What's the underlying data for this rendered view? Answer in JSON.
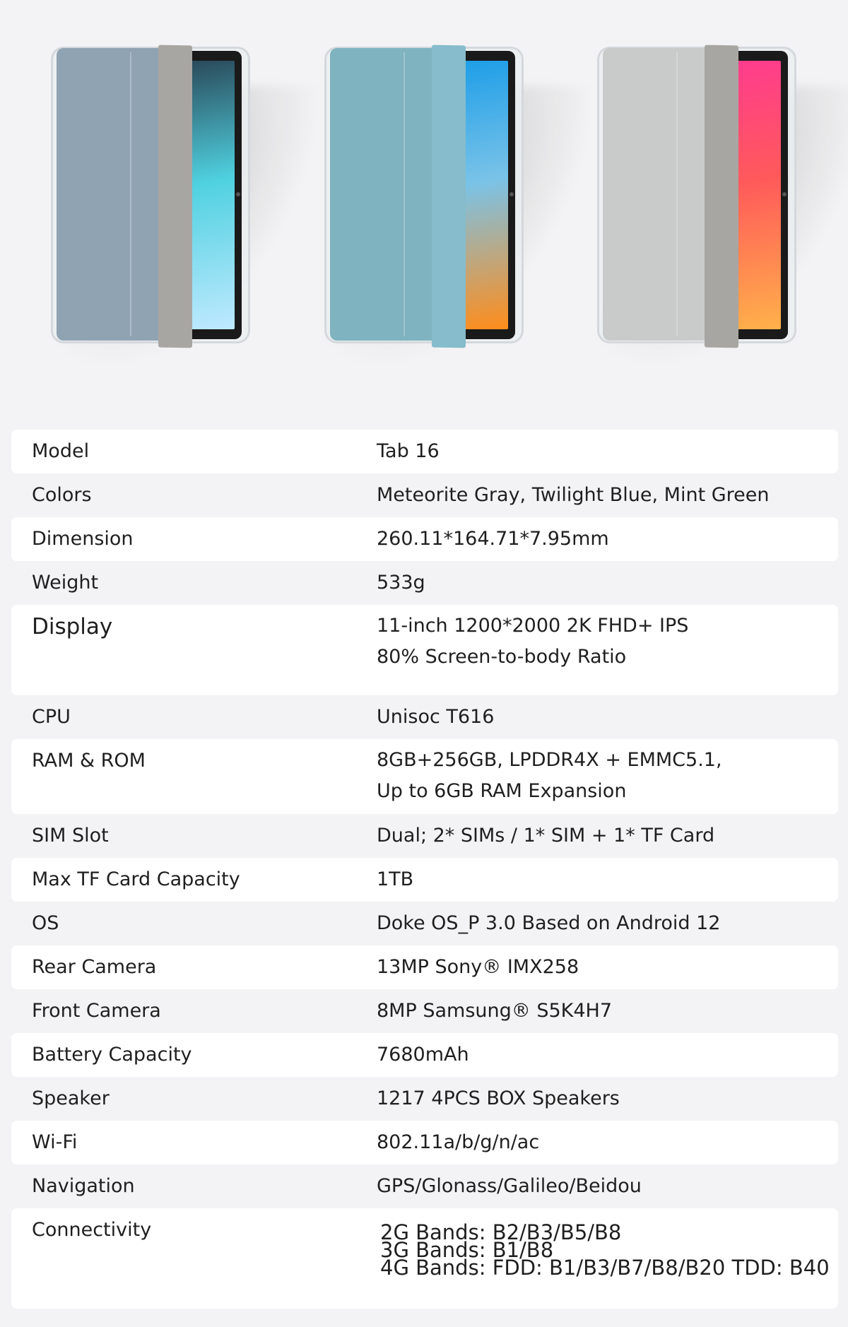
{
  "products": [
    {
      "name": "Meteorite Gray",
      "cover_color": "#8fa3b3",
      "flap_color": "#a8a6a2",
      "screen_colors": [
        "#2a4a5a",
        "#4fd1e0",
        "#bfe9ff"
      ]
    },
    {
      "name": "Twilight Blue",
      "cover_color": "#7fb3bf",
      "flap_color": "#86bccb",
      "screen_colors": [
        "#1e9ee8",
        "#7ac3e8",
        "#ff8c1a"
      ]
    },
    {
      "name": "Mint Green",
      "cover_color": "#c9cbcb",
      "flap_color": "#a8a6a2",
      "screen_colors": [
        "#ff3c8e",
        "#ff5a5a",
        "#ffb14a"
      ]
    }
  ],
  "specs": [
    {
      "label": "Model",
      "value": [
        "Tab 16"
      ]
    },
    {
      "label": "Colors",
      "value": [
        "Meteorite Gray, Twilight Blue, Mint Green"
      ]
    },
    {
      "label": "Dimension",
      "value": [
        "260.11*164.71*7.95mm"
      ]
    },
    {
      "label": "Weight",
      "value": [
        "533g"
      ]
    },
    {
      "label": "Display",
      "value": [
        "11-inch 1200*2000 2K FHD+ IPS",
        "80% Screen-to-body Ratio"
      ]
    },
    {
      "label": "CPU",
      "value": [
        "Unisoc T616"
      ]
    },
    {
      "label": "RAM & ROM",
      "value": [
        "8GB+256GB, LPDDR4X + EMMC5.1,",
        "Up to 6GB RAM Expansion"
      ]
    },
    {
      "label": "SIM Slot",
      "value": [
        "Dual; 2* SIMs / 1* SIM + 1* TF Card"
      ]
    },
    {
      "label": "Max TF Card Capacity",
      "value": [
        "1TB"
      ]
    },
    {
      "label": "OS",
      "value": [
        "Doke OS_P 3.0 Based on Android 12"
      ]
    },
    {
      "label": "Rear Camera",
      "value": [
        "13MP Sony® IMX258"
      ]
    },
    {
      "label": "Front Camera",
      "value": [
        "8MP Samsung® S5K4H7"
      ]
    },
    {
      "label": "Battery Capacity",
      "value": [
        "7680mAh"
      ]
    },
    {
      "label": "Speaker",
      "value": [
        "1217 4PCS BOX Speakers"
      ]
    },
    {
      "label": "Wi-Fi",
      "value": [
        "802.11a/b/g/n/ac"
      ]
    },
    {
      "label": "Navigation",
      "value": [
        "GPS/Glonass/Galileo/Beidou"
      ]
    },
    {
      "label": "Connectivity",
      "value": [
        "2G Bands: B2/B3/B5/B8",
        "3G Bands: B1/B8",
        "4G Bands: FDD: B1/B3/B7/B8/B20  TDD: B40"
      ]
    }
  ]
}
